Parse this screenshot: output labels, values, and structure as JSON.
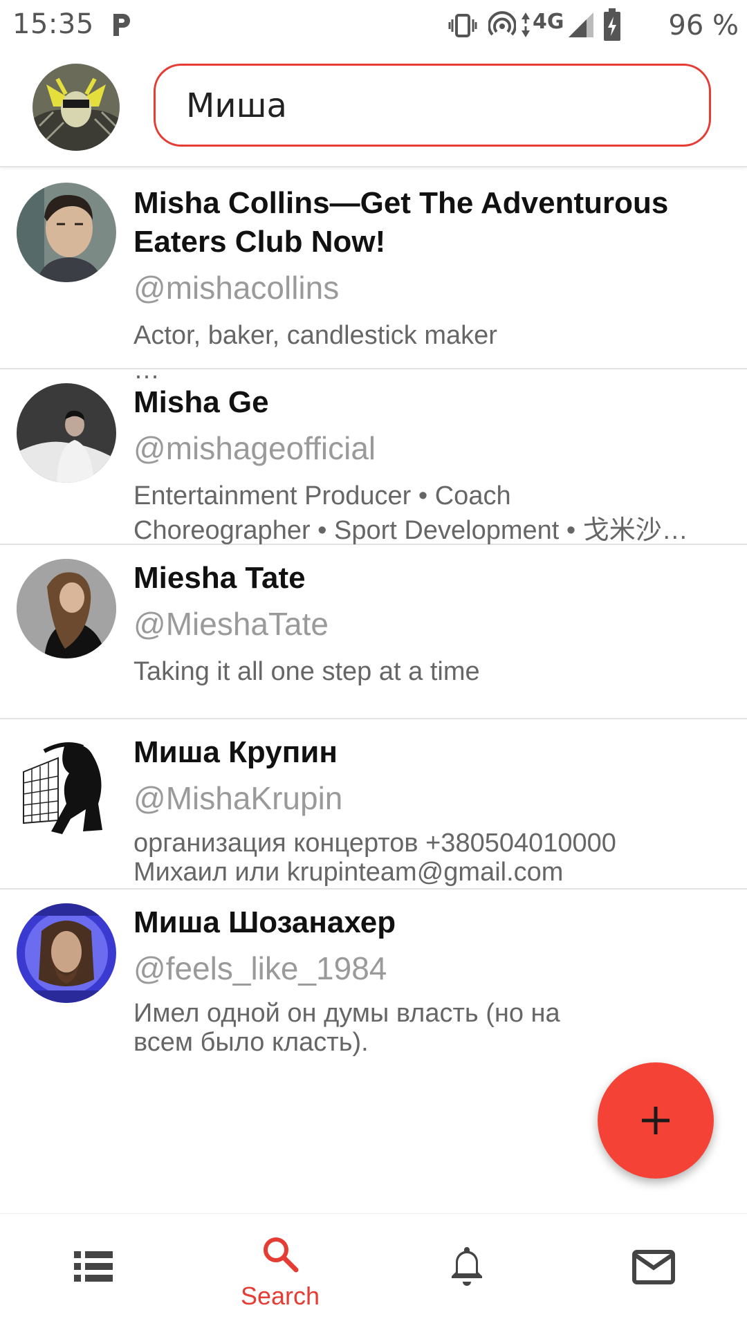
{
  "status_bar": {
    "time": "15:35",
    "network": "4G",
    "battery": "96 %"
  },
  "search": {
    "query": "Миша"
  },
  "results": [
    {
      "name": "Misha Collins—Get The Adventurous Eaters Club Now!",
      "handle": "@mishacollins",
      "bio": "Actor, baker, candlestick maker\n…"
    },
    {
      "name": "Misha Ge",
      "handle": "@mishageofficial",
      "bio": "Entertainment Producer • Coach\nChoreographer • Sport Development • 戈米沙…"
    },
    {
      "name": "Miesha Tate",
      "handle": "@MieshaTate",
      "bio": "Taking it all one step at a time"
    },
    {
      "name": "Миша Крупин",
      "handle": "@MishaKrupin",
      "bio": "организация концертов +380504010000\nМихаил или krupinteam@gmail.com"
    },
    {
      "name": "Миша Шозанахер",
      "handle": "@feels_like_1984",
      "bio": "Имел одной он думы власть (но на\nвсем было класть)."
    }
  ],
  "nav": {
    "search_label": "Search"
  },
  "colors": {
    "accent": "#e53c34",
    "fab": "#f44336"
  }
}
